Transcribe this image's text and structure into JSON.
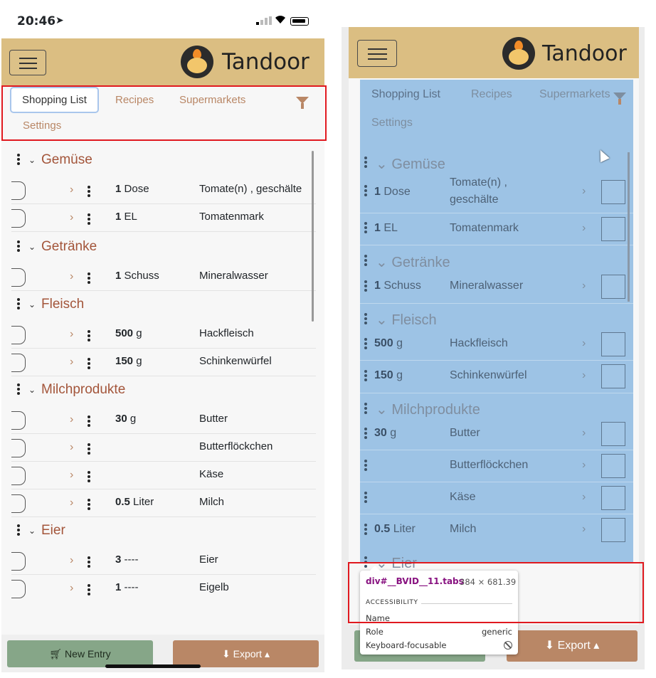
{
  "status_bar": {
    "time": "20:46"
  },
  "brand": {
    "name": "Tandoor",
    "nav_color": "#dbbe82",
    "accent": "#b98766",
    "category_color": "#a3553a"
  },
  "tabs": [
    {
      "label": "Shopping List",
      "active": true
    },
    {
      "label": "Recipes",
      "active": false
    },
    {
      "label": "Supermarkets",
      "active": false
    },
    {
      "label": "Settings",
      "active": false
    }
  ],
  "categories": [
    {
      "name": "Gemüse",
      "items": [
        {
          "amount": "1",
          "unit": "Dose",
          "food": "Tomate(n) , geschälte"
        },
        {
          "amount": "1",
          "unit": "EL",
          "food": "Tomatenmark"
        }
      ]
    },
    {
      "name": "Getränke",
      "items": [
        {
          "amount": "1",
          "unit": "Schuss",
          "food": "Mineralwasser"
        }
      ]
    },
    {
      "name": "Fleisch",
      "items": [
        {
          "amount": "500",
          "unit": "g",
          "food": "Hackfleisch"
        },
        {
          "amount": "150",
          "unit": "g",
          "food": "Schinkenwürfel"
        }
      ]
    },
    {
      "name": "Milchprodukte",
      "items": [
        {
          "amount": "30",
          "unit": "g",
          "food": "Butter"
        },
        {
          "amount": "",
          "unit": "",
          "food": "Butterflöckchen"
        },
        {
          "amount": "",
          "unit": "",
          "food": "Käse"
        },
        {
          "amount": "0.5",
          "unit": "Liter",
          "food": "Milch"
        }
      ]
    },
    {
      "name": "Eier",
      "items": [
        {
          "amount": "3",
          "unit": "----",
          "food": "Eier"
        },
        {
          "amount": "1",
          "unit": "----",
          "food": "Eigelb"
        }
      ]
    }
  ],
  "right_panel": {
    "food_1": "Tomate(n) ,",
    "food_1b": "geschälte",
    "partial_category": "Eier",
    "tooltip": {
      "selector": "div#__BVID__11.tabs",
      "size": "384 × 681.39",
      "heading": "ACCESSIBILITY",
      "name_label": "Name",
      "role_label": "Role",
      "role_value": "generic",
      "focus_label": "Keyboard-focusable"
    }
  },
  "buttons": {
    "new_entry": "New Entry",
    "export": "Export"
  }
}
